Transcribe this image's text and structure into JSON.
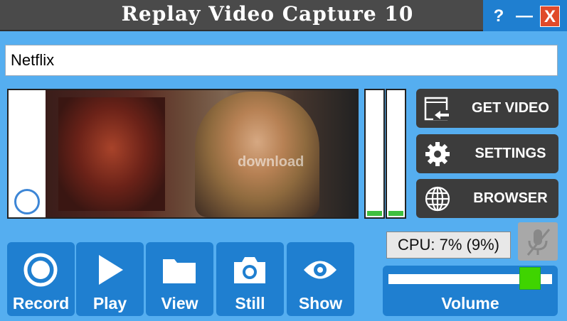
{
  "window": {
    "title": "Replay Video Capture 10",
    "help_label": "?",
    "minimize_label": "—",
    "close_label": "X"
  },
  "url_field": {
    "value": "Netflix"
  },
  "preview": {
    "watermark": "download"
  },
  "meters": {
    "left_level": 0.04,
    "right_level": 0.04
  },
  "actions": [
    {
      "label": "GET VIDEO",
      "icon": "get-video-icon"
    },
    {
      "label": "SETTINGS",
      "icon": "gear-icon"
    },
    {
      "label": "BROWSER",
      "icon": "globe-icon"
    }
  ],
  "status": {
    "cpu_text": "CPU: 7% (9%)",
    "mic_icon": "microphone-muted-icon"
  },
  "bottom_buttons": [
    {
      "label": "Record",
      "icon": "record-icon"
    },
    {
      "label": "Play",
      "icon": "play-icon"
    },
    {
      "label": "View",
      "icon": "folder-icon"
    },
    {
      "label": "Still",
      "icon": "camera-icon"
    },
    {
      "label": "Show",
      "icon": "eye-icon"
    }
  ],
  "volume": {
    "label": "Volume",
    "level": 0.92
  },
  "colors": {
    "background": "#55aef0",
    "titlebar": "#4a4a4a",
    "button_blue": "#1f7fd0",
    "action_dark": "#3c3c3c",
    "meter_green": "#3fbf3f",
    "volume_thumb": "#3fd400",
    "close_red": "#e04a2a"
  }
}
